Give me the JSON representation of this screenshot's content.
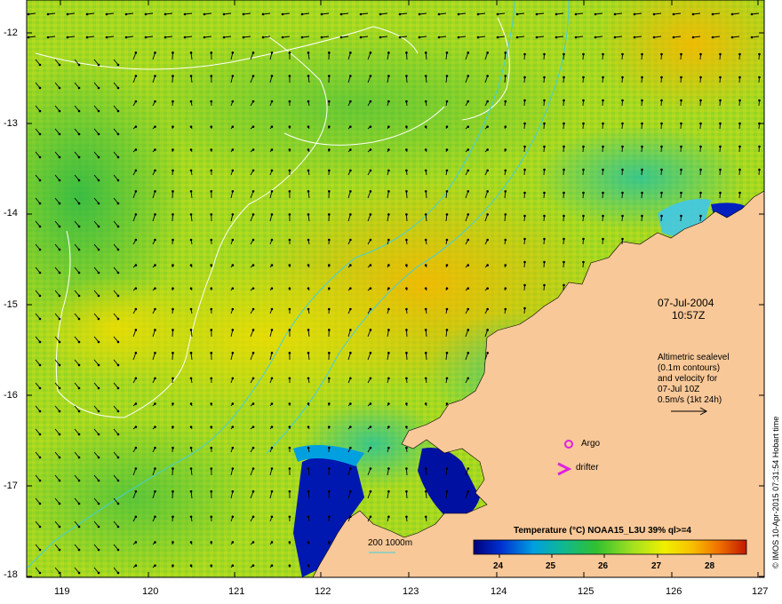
{
  "map": {
    "date": "07-Jul-2004",
    "time": "10:57Z",
    "info_lines": [
      "Altimetric sealevel",
      "(0.1m contours)",
      "and velocity for",
      "07-Jul 10Z",
      "0.5m/s (1kt 24h)"
    ],
    "argo_label": "Argo",
    "drifter_label": "drifter",
    "bathymetry_label": "200  1000m",
    "colorbar_title": "Temperature (°C) NOAA15_L3U 39% ql>=4",
    "colorbar_ticks": [
      "24",
      "25",
      "26",
      "27",
      "28"
    ],
    "credit": "© IMOS 10-Apr-2015 07:31:54 Hobart time",
    "lat_labels": [
      "-12",
      "-13",
      "-14",
      "-15",
      "-16",
      "-17",
      "-18"
    ],
    "lon_labels": [
      "119",
      "120",
      "121",
      "122",
      "123",
      "124",
      "125",
      "126",
      "127"
    ],
    "colors": {
      "land": "#f8c898",
      "contour": "#ffffff",
      "bathymetry": "#40d0e0",
      "argo": "#e020e0",
      "drifter": "#e020e0",
      "arrow": "#000000",
      "colorbar": [
        "#00007a",
        "#0030d0",
        "#00a0e0",
        "#10b890",
        "#30c030",
        "#a0e020",
        "#f0f000",
        "#f8c000",
        "#f07000",
        "#c01800"
      ]
    }
  }
}
